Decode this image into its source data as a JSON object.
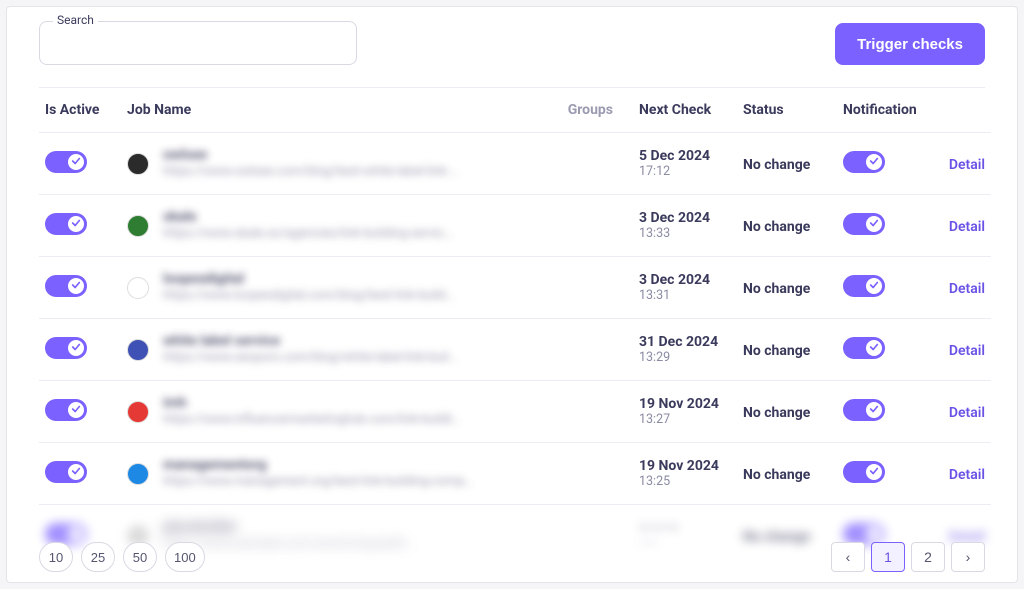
{
  "search": {
    "label": "Search",
    "value": ""
  },
  "trigger_label": "Trigger checks",
  "columns": {
    "active": "Is Active",
    "job": "Job Name",
    "groups": "Groups",
    "next": "Next Check",
    "status": "Status",
    "notif": "Notification"
  },
  "detail_label": "Detail",
  "rows": [
    {
      "icon_color": "#2b2b2b",
      "title": "owlsee",
      "url": "https://www.owlsee.com/blog/best-white-label-link-…",
      "date": "5 Dec 2024",
      "time": "17:12",
      "status": "No change"
    },
    {
      "icon_color": "#2e7d32",
      "title": "skale",
      "url": "https://www.skale.so/agencies/link-building-servic…",
      "date": "3 Dec 2024",
      "time": "13:33",
      "status": "No change"
    },
    {
      "icon_color": "#ffffff",
      "title": "loopexdigital",
      "url": "https://www.loopexdigital.com/blog/best-link-build…",
      "date": "3 Dec 2024",
      "time": "13:31",
      "status": "No change"
    },
    {
      "icon_color": "#3f51b5",
      "title": "white label service",
      "url": "https://www.seoporo.com/blog/white-label-link-buil…",
      "date": "31 Dec 2024",
      "time": "13:29",
      "status": "No change"
    },
    {
      "icon_color": "#e53935",
      "title": "imh",
      "url": "https://www.influencermarketinghub.com/link-buildi…",
      "date": "19 Nov 2024",
      "time": "13:27",
      "status": "No change"
    },
    {
      "icon_color": "#1e88e5",
      "title": "managementorg",
      "url": "https://www.management.org/best-link-building-comp…",
      "date": "19 Nov 2024",
      "time": "13:25",
      "status": "No change"
    }
  ],
  "page_sizes": [
    "10",
    "25",
    "50",
    "100"
  ],
  "pager": {
    "prev": "‹",
    "pages": [
      "1",
      "2"
    ],
    "next": "›",
    "active": "1"
  }
}
